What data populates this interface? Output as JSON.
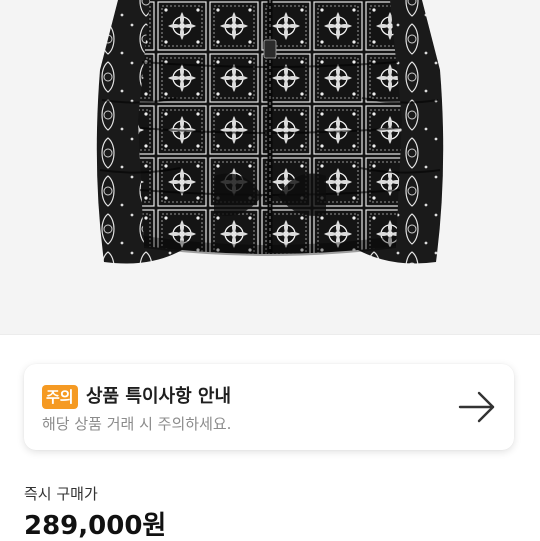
{
  "product_image": {
    "alt": "black bandana paisley puffer jacket"
  },
  "notice": {
    "badge": "주의",
    "title": "상품 특이사항 안내",
    "subtitle": "해당 상품 거래 시 주의하세요.",
    "arrow_icon": "arrow-right-icon",
    "badge_color": "#f59a23"
  },
  "price": {
    "label": "즉시 구매가",
    "amount": "289,000원"
  }
}
